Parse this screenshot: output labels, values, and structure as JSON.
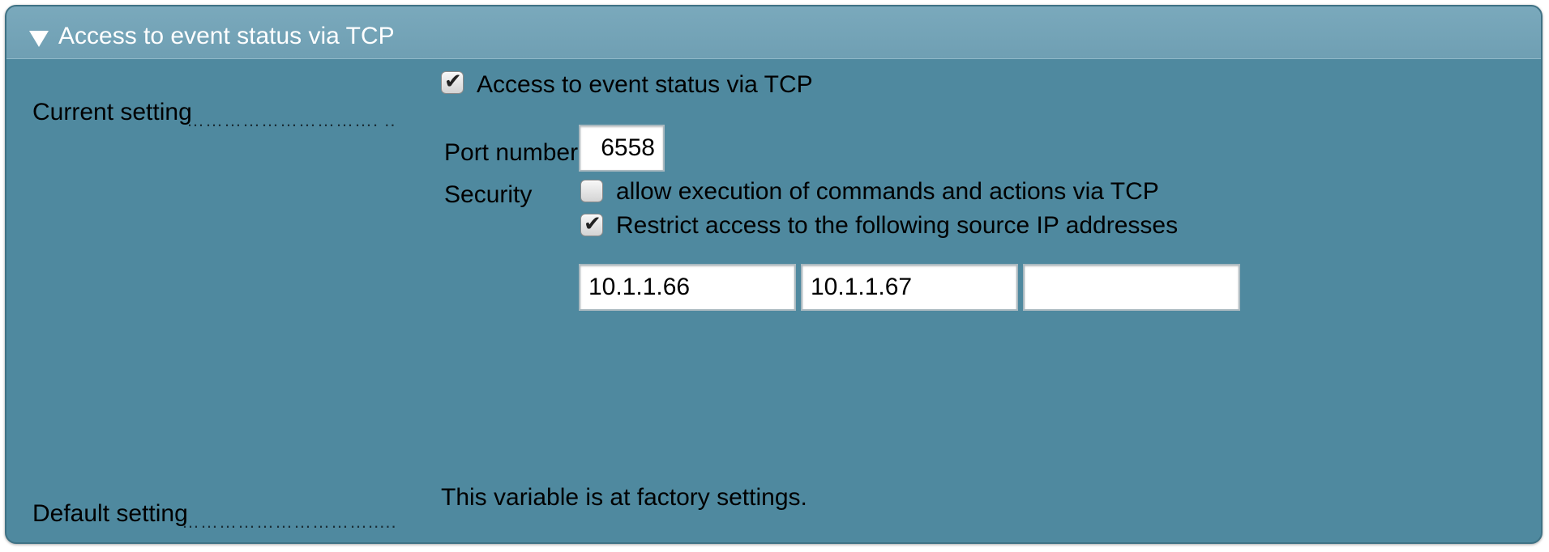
{
  "section": {
    "title": "Access to event status via TCP"
  },
  "current_setting": {
    "label": "Current setting",
    "dots": "…………………………. ..",
    "enable_checkbox": {
      "label": "Access to event status via TCP",
      "checked": true
    }
  },
  "port": {
    "label": "Port number:",
    "value": "6558"
  },
  "security": {
    "label": "Security",
    "allow_exec": {
      "label": "allow execution of commands and actions via TCP",
      "checked": false
    },
    "restrict_ips": {
      "label": "Restrict access to the following source IP addresses",
      "checked": true
    }
  },
  "ip_addresses": [
    "10.1.1.66",
    "10.1.1.67",
    ""
  ],
  "default_setting": {
    "label": "Default setting",
    "dots": "………………………….....",
    "text": "This variable is at factory settings."
  },
  "colors": {
    "panel": "#4f899f",
    "header": "#74a4b7",
    "header_text": "#ffffff"
  },
  "icons": {
    "collapse": "triangle-down-icon",
    "check": "checkmark-icon"
  }
}
